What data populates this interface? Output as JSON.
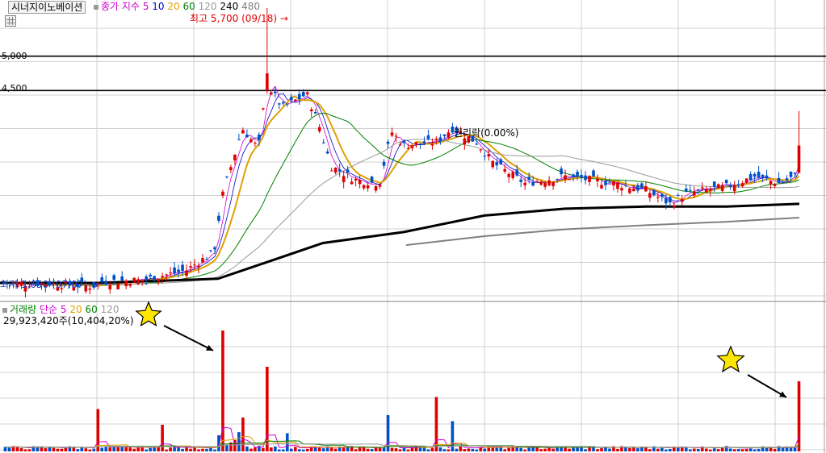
{
  "header": {
    "stock_name": "시너지이노베이션",
    "indicator_label": "종가 지수",
    "ma_periods": [
      "5",
      "10",
      "20",
      "60",
      "120",
      "240",
      "480"
    ],
    "ma_colors": [
      "#d000d0",
      "#0000c8",
      "#e0a000",
      "#008000",
      "#9a9a9a",
      "#000000",
      "#808080"
    ]
  },
  "price_panel": {
    "level_lines": [
      {
        "label": "5,000",
        "value": 5000
      },
      {
        "label": "4,500",
        "value": 4500
      }
    ],
    "high_label": "최고 5,700 (09/18)",
    "low_label": "최저 1,650 (07/07)",
    "ex_rights_label": "권리락(0.00%)"
  },
  "volume_panel": {
    "title": "거래량",
    "indicator_label": "단순",
    "ma_periods": [
      "5",
      "20",
      "60",
      "120"
    ],
    "ma_colors": [
      "#d000d0",
      "#e0a000",
      "#008000",
      "#9a9a9a"
    ],
    "info": "29,923,420주(10,404,20%)"
  },
  "colors": {
    "up": "#e00000",
    "down": "#0050c8",
    "annotation_star": "#ffe600",
    "arrow": "#000000",
    "grid": "#d0d0d0"
  },
  "annotations": [
    {
      "type": "star-arrow",
      "target": "volume-spike-1"
    },
    {
      "type": "star-arrow",
      "target": "volume-spike-latest"
    }
  ],
  "chart_data": {
    "type": "candlestick",
    "price_scale": {
      "min": 1500,
      "max": 5700,
      "level_lines": [
        5000,
        4500
      ]
    },
    "price_path_key_points": [
      {
        "phase": "start",
        "close": 1700
      },
      {
        "phase": "low",
        "close": 1650,
        "label": "07/07"
      },
      {
        "phase": "breakout",
        "close": 2300
      },
      {
        "phase": "high",
        "high": 5700,
        "label": "09/18"
      },
      {
        "phase": "plateau",
        "close": 4300
      },
      {
        "phase": "pullback",
        "close": 3300
      },
      {
        "phase": "second-peak",
        "close": 4100
      },
      {
        "phase": "sideways",
        "close": 3200
      },
      {
        "phase": "dip",
        "close": 2900
      },
      {
        "phase": "latest",
        "close": 3400,
        "high": 4200
      }
    ],
    "volume_spikes": [
      {
        "name": "volume-spike-1",
        "relative": 1.0
      },
      {
        "name": "volume-spike-2",
        "relative": 0.7
      },
      {
        "name": "volume-spike-latest",
        "relative": 0.58
      }
    ]
  }
}
